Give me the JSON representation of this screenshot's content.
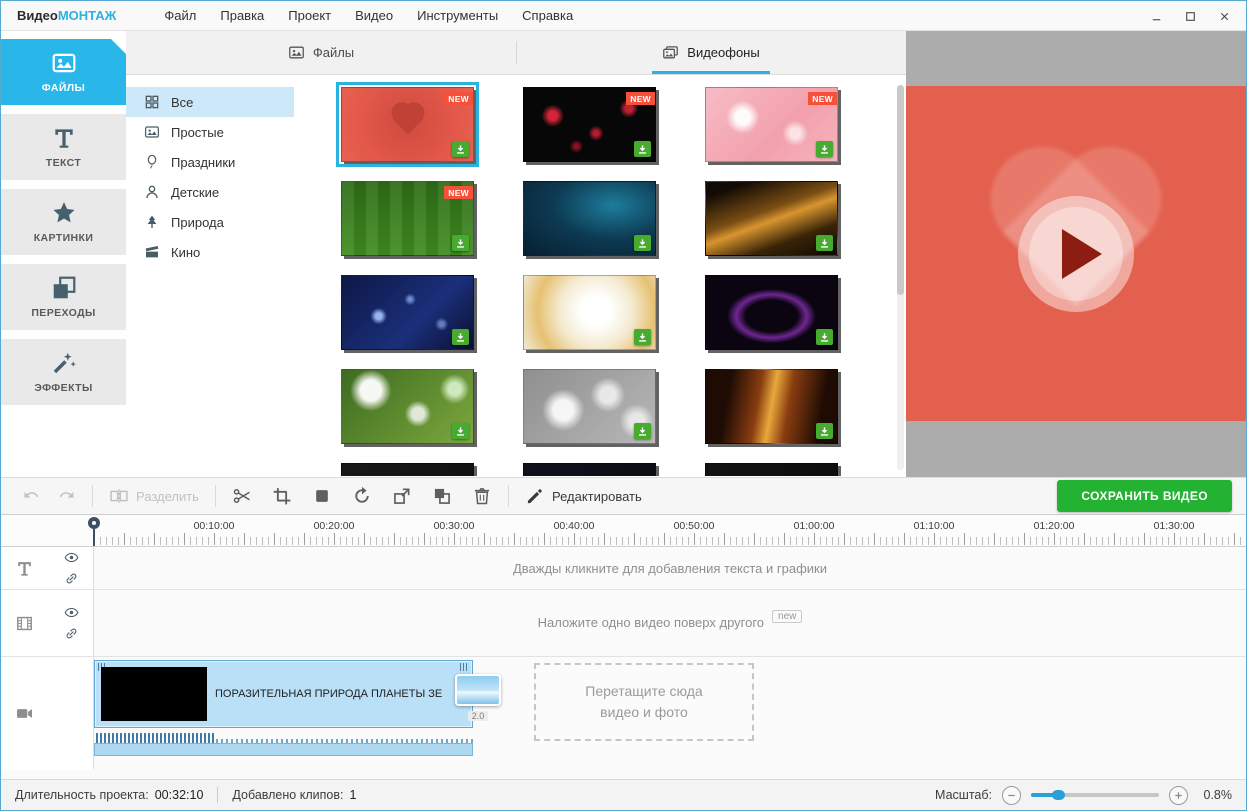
{
  "colors": {
    "accent_blue": "#29b6e8",
    "save_green": "#24b232",
    "download_green": "#46ab2f",
    "new_badge_red": "#f4503a",
    "preview_coral": "#e4604e",
    "category_selected": "#cde8f8"
  },
  "menubar": {
    "logo_prefix": "Видео",
    "logo_suffix": "МОНТАЖ",
    "items": [
      "Файл",
      "Правка",
      "Проект",
      "Видео",
      "Инструменты",
      "Справка"
    ],
    "window_controls": [
      "minimize",
      "maximize",
      "close"
    ]
  },
  "sidebar": {
    "items": [
      {
        "id": "files",
        "label": "ФАЙЛЫ",
        "icon": "files-icon",
        "active": true
      },
      {
        "id": "text",
        "label": "ТЕКСТ",
        "icon": "text-icon",
        "active": false
      },
      {
        "id": "pictures",
        "label": "КАРТИНКИ",
        "icon": "star-icon",
        "active": false
      },
      {
        "id": "transitions",
        "label": "ПЕРЕХОДЫ",
        "icon": "transitions-icon",
        "active": false
      },
      {
        "id": "effects",
        "label": "ЭФФЕКТЫ",
        "icon": "effects-icon",
        "active": false
      }
    ]
  },
  "browser": {
    "tabs": [
      {
        "id": "files",
        "label": "Файлы",
        "icon": "image-icon",
        "active": false
      },
      {
        "id": "videobg",
        "label": "Видеофоны",
        "icon": "videobg-icon",
        "active": true
      }
    ],
    "categories": [
      {
        "id": "all",
        "label": "Все",
        "icon": "grid-icon",
        "active": true
      },
      {
        "id": "simple",
        "label": "Простые",
        "icon": "image-icon",
        "active": false
      },
      {
        "id": "holidays",
        "label": "Праздники",
        "icon": "balloon-icon",
        "active": false
      },
      {
        "id": "kids",
        "label": "Детские",
        "icon": "child-icon",
        "active": false
      },
      {
        "id": "nature",
        "label": "Природа",
        "icon": "nature-icon",
        "active": false
      },
      {
        "id": "cinema",
        "label": "Кино",
        "icon": "cinema-icon",
        "active": false
      }
    ],
    "new_badge": "NEW",
    "thumbnails": [
      {
        "name": "red-heart",
        "new": true,
        "selected": true,
        "shape": "heart",
        "bg": "radial-gradient(circle at 50% 48%, #cf4a3d 0%, #e2584a 62%, #e8614f 100%)"
      },
      {
        "name": "black-red-particles",
        "new": true,
        "selected": false,
        "bg": "radial-gradient(circle at 22% 38%, rgba(224,38,58,0.95) 0 4%, transparent 10%), radial-gradient(circle at 55% 62%, rgba(200,30,52,0.9) 0 3%, transparent 9%), radial-gradient(circle at 80% 28%, rgba(224,38,58,0.85) 0 3%, transparent 8%), radial-gradient(circle at 40% 80%, rgba(170,22,44,0.8) 0 2%, transparent 7%), #070707"
      },
      {
        "name": "pink-hearts",
        "new": true,
        "selected": false,
        "bg": "radial-gradient(circle at 28% 40%, rgba(255,255,255,0.95) 0 7%, transparent 16%), radial-gradient(circle at 68% 62%, rgba(255,255,255,0.7) 0 5%, transparent 13%), linear-gradient(135deg, #f7bcc6 0%, #f2a0ac 60%, #f6b4be 100%)"
      },
      {
        "name": "football-field",
        "new": true,
        "selected": false,
        "bg": "repeating-linear-gradient(90deg, rgba(255,255,255,0.07) 0 12px, rgba(0,0,0,0.05) 12px 24px), linear-gradient(180deg, #2e6b16 0%, #3f8c20 100%)"
      },
      {
        "name": "teal-abstract",
        "new": false,
        "selected": false,
        "bg": "radial-gradient(ellipse at 68% 32%, #1d7d9c 0%, #0d3a52 48%, #071f30 100%)"
      },
      {
        "name": "golden-waves",
        "new": false,
        "selected": false,
        "bg": "linear-gradient(160deg, #120a04 12%, #7a4e14 42%, #d8952f 52%, #3a2408 74%, #0d0803 100%)"
      },
      {
        "name": "blue-particles",
        "new": false,
        "selected": false,
        "bg": "radial-gradient(circle at 28% 55%, rgba(165,195,255,0.9) 0 3%, transparent 8%), radial-gradient(circle at 52% 32%, rgba(150,180,255,0.7) 0 2%, transparent 7%), radial-gradient(circle at 76% 66%, rgba(150,180,255,0.6) 0 2%, transparent 6%), linear-gradient(135deg, #0d1845 0%, #1b2f7a 60%, #0a1030 100%)"
      },
      {
        "name": "gold-flower",
        "new": false,
        "selected": false,
        "bg": "radial-gradient(circle at 55% 48%, #ffffff 18%, #f4ead0 45%, #e6c171 72%, #f0ead8 100%)"
      },
      {
        "name": "purple-ring",
        "new": false,
        "selected": false,
        "bg": "radial-gradient(ellipse at 50% 55%, rgba(10,5,16,0) 28%, rgba(128,44,168,0.85) 38%, rgba(10,5,16,0) 48%), #0a0510"
      },
      {
        "name": "green-bokeh",
        "new": false,
        "selected": false,
        "bg": "radial-gradient(circle at 22% 28%, rgba(255,255,255,0.95) 0 9%, transparent 18%), radial-gradient(circle at 58% 60%, rgba(255,255,255,0.8) 0 7%, transparent 15%), radial-gradient(circle at 86% 26%, rgba(232,255,222,0.8) 0 5%, transparent 12%), linear-gradient(135deg, #3e6b1f 0%, #7ca83e 100%)"
      },
      {
        "name": "gray-bokeh",
        "new": false,
        "selected": false,
        "bg": "radial-gradient(circle at 30% 55%, rgba(255,255,255,0.9) 0 10%, transparent 21%), radial-gradient(circle at 64% 34%, rgba(255,255,255,0.75) 0 8%, transparent 18%), radial-gradient(circle at 86% 70%, rgba(255,255,255,0.7) 0 6%, transparent 14%), linear-gradient(135deg, #8f8f8f 0%, #b8b8b8 100%)"
      },
      {
        "name": "golden-lines",
        "new": false,
        "selected": false,
        "bg": "linear-gradient(100deg, #1d0b04 18%, #8a3d10 40%, #e8a83c 50%, #8a3d10 62%, #1d0b04 86%)"
      },
      {
        "name": "dark-background-1",
        "new": false,
        "selected": false,
        "bg": "linear-gradient(135deg, #181818, #101010)"
      },
      {
        "name": "dark-background-2",
        "new": false,
        "selected": false,
        "bg": "linear-gradient(135deg, #11111c, #0a0a12)"
      },
      {
        "name": "dark-background-3",
        "new": false,
        "selected": false,
        "bg": "linear-gradient(135deg, #121212, #0c0c0c)"
      }
    ]
  },
  "toolbar": {
    "split_label": "Разделить",
    "tools": [
      {
        "name": "scissors",
        "icon": "scissors-icon"
      },
      {
        "name": "crop",
        "icon": "crop-icon"
      },
      {
        "name": "frame",
        "icon": "frame-icon"
      },
      {
        "name": "rotate",
        "icon": "rotate-icon"
      },
      {
        "name": "replace",
        "icon": "replace-icon"
      },
      {
        "name": "layers",
        "icon": "layers-icon"
      },
      {
        "name": "delete",
        "icon": "trash-icon"
      }
    ],
    "edit_label": "Редактировать",
    "save_label": "СОХРАНИТЬ ВИДЕО"
  },
  "timeline": {
    "ruler_labels": [
      "00:10:00",
      "00:20:00",
      "00:30:00",
      "00:40:00",
      "00:50:00",
      "01:00:00",
      "01:10:00",
      "01:20:00",
      "01:30:00"
    ],
    "tracks": {
      "text_hint": "Дважды кликните для добавления текста и графики",
      "overlay_hint": "Наложите одно видео поверх другого",
      "overlay_badge": "new",
      "clip_title": "ПОРАЗИТЕЛЬНАЯ ПРИРОДА ПЛАНЕТЫ ЗЕ",
      "transition_value": "2.0",
      "dropzone_text": "Перетащите сюда видео и фото"
    }
  },
  "statusbar": {
    "duration_label": "Длительность проекта:",
    "duration_value": "00:32:10",
    "clips_label": "Добавлено клипов:",
    "clips_value": "1",
    "zoom_label": "Масштаб:",
    "zoom_value": "0.8%"
  }
}
